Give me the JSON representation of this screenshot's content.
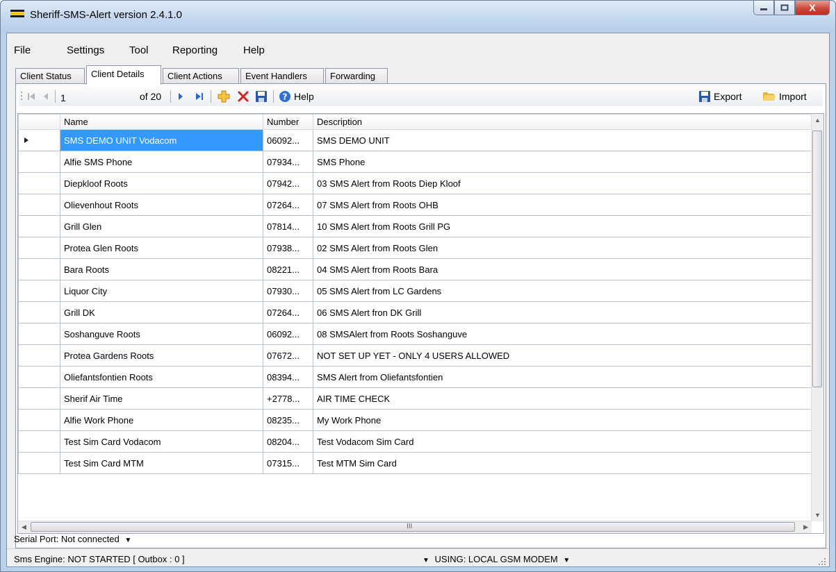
{
  "window": {
    "title": "Sheriff-SMS-Alert version 2.4.1.0",
    "controls": {
      "minimize": "–",
      "maximize": "□",
      "close": "X"
    }
  },
  "menu": [
    "File",
    "Settings",
    "Tool",
    "Reporting",
    "Help"
  ],
  "tabs": [
    {
      "label": "Client Status",
      "active": false
    },
    {
      "label": "Client Details",
      "active": true
    },
    {
      "label": "Client Actions",
      "active": false
    },
    {
      "label": "Event Handlers",
      "active": false
    },
    {
      "label": "Forwarding",
      "active": false
    }
  ],
  "toolbar": {
    "position": "1",
    "of_label": "of 20",
    "help_label": "Help",
    "export_label": "Export",
    "import_label": "Import"
  },
  "grid": {
    "columns": [
      "Name",
      "Number",
      "Description"
    ],
    "rows": [
      {
        "name": "SMS DEMO UNIT Vodacom",
        "number": "06092...",
        "description": "SMS DEMO UNIT"
      },
      {
        "name": "Alfie SMS Phone",
        "number": "07934...",
        "description": "SMS Phone"
      },
      {
        "name": "Diepkloof Roots",
        "number": "07942...",
        "description": "03 SMS Alert from Roots Diep Kloof"
      },
      {
        "name": "Olievenhout Roots",
        "number": "07264...",
        "description": "07 SMS Alert from Roots OHB"
      },
      {
        "name": "Grill Glen",
        "number": "07814...",
        "description": "10 SMS Alert from Roots Grill PG"
      },
      {
        "name": "Protea Glen Roots",
        "number": "07938...",
        "description": "02 SMS Alert from Roots Glen"
      },
      {
        "name": "Bara Roots",
        "number": "08221...",
        "description": "04 SMS Alert from Roots Bara"
      },
      {
        "name": "Liquor City",
        "number": "07930...",
        "description": "05 SMS Alert from LC Gardens"
      },
      {
        "name": "Grill DK",
        "number": "07264...",
        "description": "06 SMS Alert fron DK Grill"
      },
      {
        "name": "Soshanguve Roots",
        "number": "06092...",
        "description": "08 SMSAlert from Roots Soshanguve"
      },
      {
        "name": "Protea Gardens Roots",
        "number": "07672...",
        "description": "NOT SET UP YET - ONLY 4 USERS ALLOWED"
      },
      {
        "name": "Oliefantsfontien Roots",
        "number": "08394...",
        "description": "SMS Alert from Oliefantsfontien"
      },
      {
        "name": "Sherif Air Time",
        "number": "+2778...",
        "description": "AIR TIME CHECK"
      },
      {
        "name": "Alfie Work Phone",
        "number": "08235...",
        "description": "My Work Phone"
      },
      {
        "name": "Test Sim Card Vodacom",
        "number": "08204...",
        "description": "Test Vodacom Sim Card"
      },
      {
        "name": "Test Sim Card MTM",
        "number": "07315...",
        "description": "Test MTM Sim Card"
      }
    ],
    "selected_row": 0,
    "hscroll_mark": "III"
  },
  "status": {
    "serial_port": "Serial Port: Not connected",
    "sms_engine": "Sms Engine: NOT STARTED [ Outbox : 0 ]",
    "using": "USING: LOCAL GSM MODEM"
  },
  "colors": {
    "selection": "#3399ff",
    "save_icon": "#2a57a8",
    "delete_icon": "#d42020",
    "add_icon": "#e8a317"
  }
}
